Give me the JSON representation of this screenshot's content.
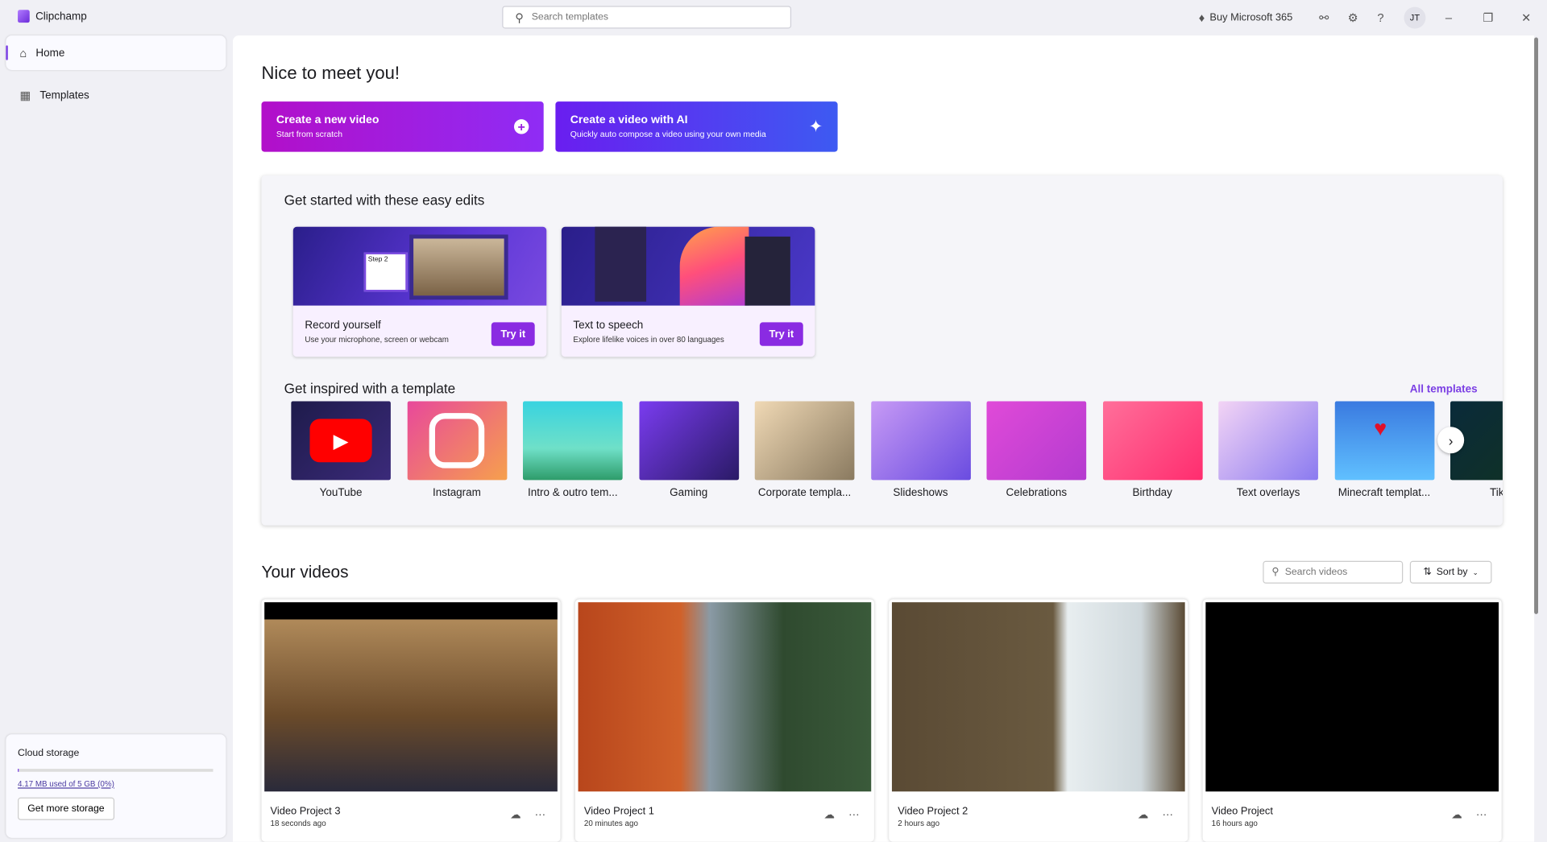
{
  "app": {
    "title": "Clipchamp"
  },
  "topbar": {
    "search_placeholder": "Search templates",
    "buy_label": "Buy Microsoft 365",
    "avatar": "JT"
  },
  "sidebar": {
    "items": [
      {
        "label": "Home",
        "icon": "home-icon",
        "active": true
      },
      {
        "label": "Templates",
        "icon": "templates-icon"
      }
    ],
    "storage": {
      "title": "Cloud storage",
      "usage": "4.17 MB used of 5 GB (0%)",
      "percent": 0.1,
      "button": "Get more storage"
    }
  },
  "main": {
    "greeting": "Nice to meet you!",
    "cta": [
      {
        "title": "Create a new video",
        "subtitle": "Start from scratch",
        "icon": "plus-circle-icon"
      },
      {
        "title": "Create a video with AI",
        "subtitle": "Quickly auto compose a video using your own media",
        "icon": "sparkle-icon"
      }
    ],
    "easy_edits": {
      "heading": "Get started with these easy edits",
      "cards": [
        {
          "title": "Record yourself",
          "desc": "Use your microphone, screen or webcam",
          "button": "Try it",
          "thumb_label": "Step 2"
        },
        {
          "title": "Text to speech",
          "desc": "Explore lifelike voices in over 80 languages",
          "button": "Try it"
        }
      ]
    },
    "templates": {
      "heading": "Get inspired with a template",
      "all_link": "All templates",
      "items": [
        "YouTube",
        "Instagram",
        "Intro & outro tem...",
        "Gaming",
        "Corporate templa...",
        "Slideshows",
        "Celebrations",
        "Birthday",
        "Text overlays",
        "Minecraft templat...",
        "TikT"
      ]
    },
    "videos": {
      "heading": "Your videos",
      "search_placeholder": "Search videos",
      "sort_label": "Sort by",
      "items": [
        {
          "name": "Video Project 3",
          "time": "18 seconds ago"
        },
        {
          "name": "Video Project 1",
          "time": "20 minutes ago"
        },
        {
          "name": "Video Project 2",
          "time": "2 hours ago"
        },
        {
          "name": "Video Project",
          "time": "16 hours ago"
        }
      ]
    }
  },
  "colors": {
    "accent": "#8a2be2",
    "cta1": "#b20fc9",
    "cta2": "#4b50f0"
  }
}
